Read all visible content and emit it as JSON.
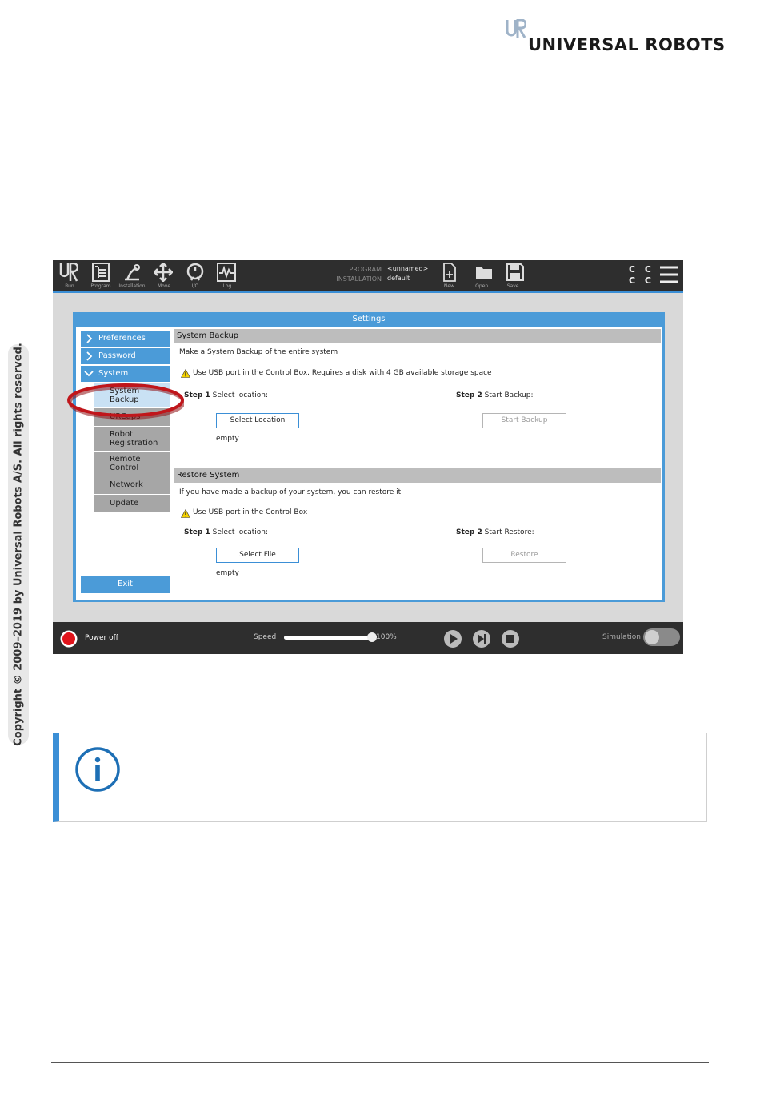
{
  "brand": {
    "name": "UNIVERSAL ROBOTS"
  },
  "copyright": "Copyright © 2009–2019 by Universal Robots A/S. All rights reserved.",
  "screenshot": {
    "toolbar": {
      "items": [
        {
          "label": "Run",
          "icon": "ur-logo-icon"
        },
        {
          "label": "Program",
          "icon": "program-icon"
        },
        {
          "label": "Installation",
          "icon": "installation-icon"
        },
        {
          "label": "Move",
          "icon": "move-icon"
        },
        {
          "label": "I/O",
          "icon": "io-icon"
        },
        {
          "label": "Log",
          "icon": "log-icon"
        }
      ],
      "program_key": "PROGRAM",
      "program_value": "<unnamed>",
      "installation_key": "INSTALLATION",
      "installation_value": "default",
      "file_actions": [
        {
          "label": "New...",
          "icon": "new-file-icon"
        },
        {
          "label": "Open...",
          "icon": "open-folder-icon"
        },
        {
          "label": "Save...",
          "icon": "save-disk-icon"
        }
      ],
      "cc_top": "C C",
      "cc_bottom": "C C"
    },
    "settings": {
      "title": "Settings",
      "nav": {
        "preferences": "Preferences",
        "password": "Password",
        "system": "System",
        "sub_items": [
          "System Backup",
          "URCaps",
          "Robot Registration",
          "Remote Control",
          "Network",
          "Update"
        ],
        "system_backup_line1": "System",
        "system_backup_line2": "Backup",
        "robot_reg_line1": "Robot",
        "robot_reg_line2": "Registration",
        "remote_line1": "Remote",
        "remote_line2": "Control",
        "exit": "Exit"
      },
      "backup": {
        "heading": "System Backup",
        "description": "Make a System Backup of the entire system",
        "warning": "Use USB port in the Control Box. Requires a disk with 4 GB available storage space",
        "step1_bold": "Step 1",
        "step1_text": "Select location:",
        "step2_bold": "Step 2",
        "step2_text": "Start Backup:",
        "select_button": "Select Location",
        "start_button": "Start Backup",
        "status": "empty"
      },
      "restore": {
        "heading": "Restore System",
        "description": "If you have made a backup of your system, you can restore it",
        "warning": "Use USB port in the Control Box",
        "step1_bold": "Step 1",
        "step1_text": "Select location:",
        "step2_bold": "Step 2",
        "step2_text": "Start Restore:",
        "select_button": "Select File",
        "restore_button": "Restore",
        "status": "empty"
      }
    },
    "bottombar": {
      "power": "Power off",
      "speed_label": "Speed",
      "speed_value": "100%",
      "speed_level": 1.0,
      "simulation": "Simulation"
    }
  },
  "colors": {
    "accent": "#3b8fd6",
    "highlight_ring": "#c0161b",
    "power_red": "#e0141b"
  }
}
